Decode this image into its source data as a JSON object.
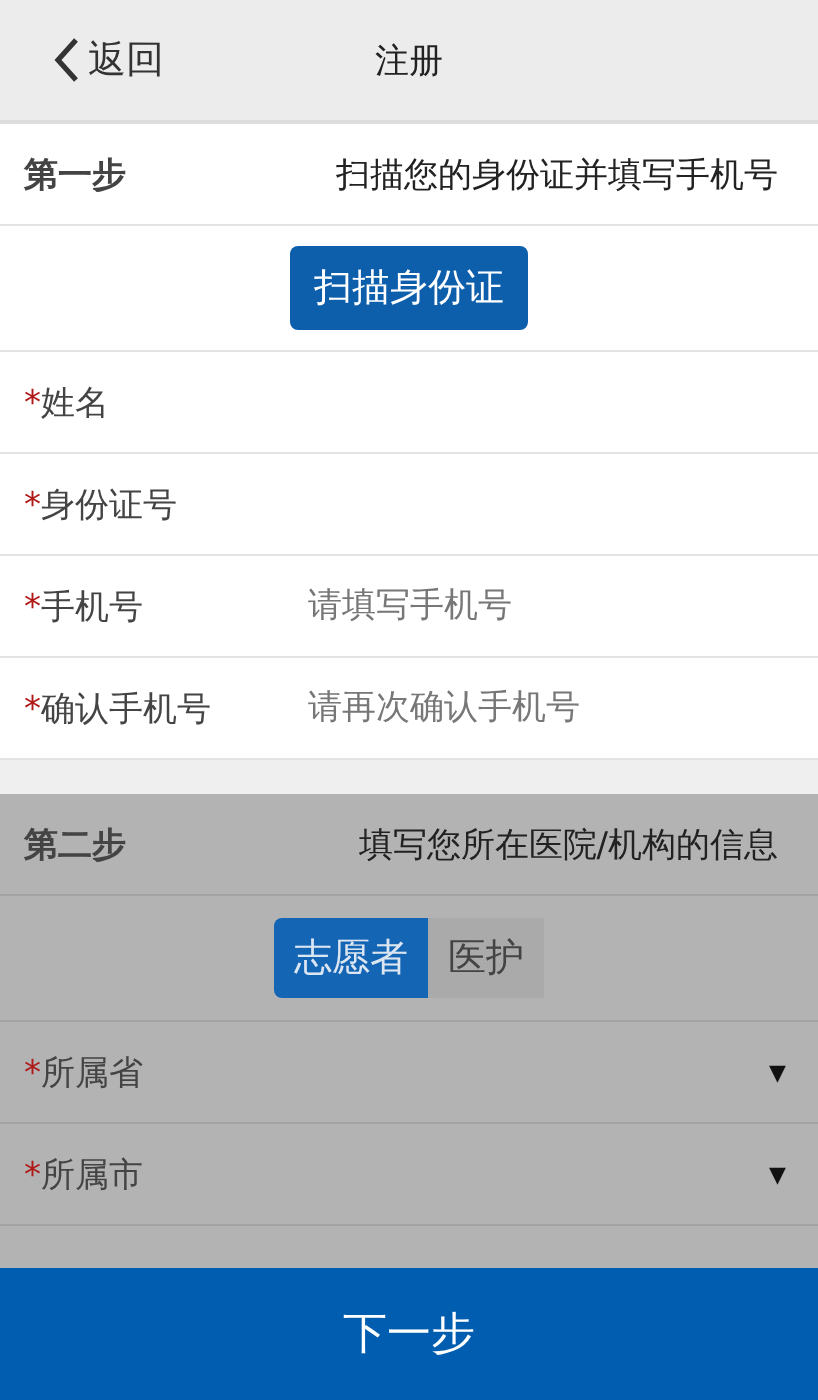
{
  "header": {
    "back": "返回",
    "title": "注册"
  },
  "steps": [
    {
      "label": "第一步",
      "description": "扫描您的身份证并填写手机号",
      "disabled": false,
      "rows": [
        {
          "kind": "button",
          "text": "扫描身份证"
        },
        {
          "kind": "field",
          "label": "姓名",
          "marker": "*"
        },
        {
          "kind": "field",
          "label": "身份证号",
          "marker": "*"
        },
        {
          "kind": "field",
          "label": "手机号",
          "marker": "*",
          "placeholder": "请填写手机号"
        },
        {
          "kind": "field",
          "label": "确认手机号",
          "marker": "*",
          "placeholder": "请再次确认手机号"
        }
      ]
    },
    {
      "label": "第二步",
      "description": "填写您所在医院/机构的信息",
      "disabled": true,
      "rows": [
        {
          "kind": "toggle",
          "options": [
            {
              "label": "志愿者",
              "selected": true
            },
            {
              "label": "医护",
              "selected": false
            }
          ]
        },
        {
          "kind": "select",
          "label": "所属省",
          "marker": "*",
          "arrow": "▼"
        },
        {
          "kind": "select",
          "label": "所属市",
          "marker": "*",
          "arrow": "▼"
        }
      ]
    }
  ],
  "next_button": "下一步"
}
